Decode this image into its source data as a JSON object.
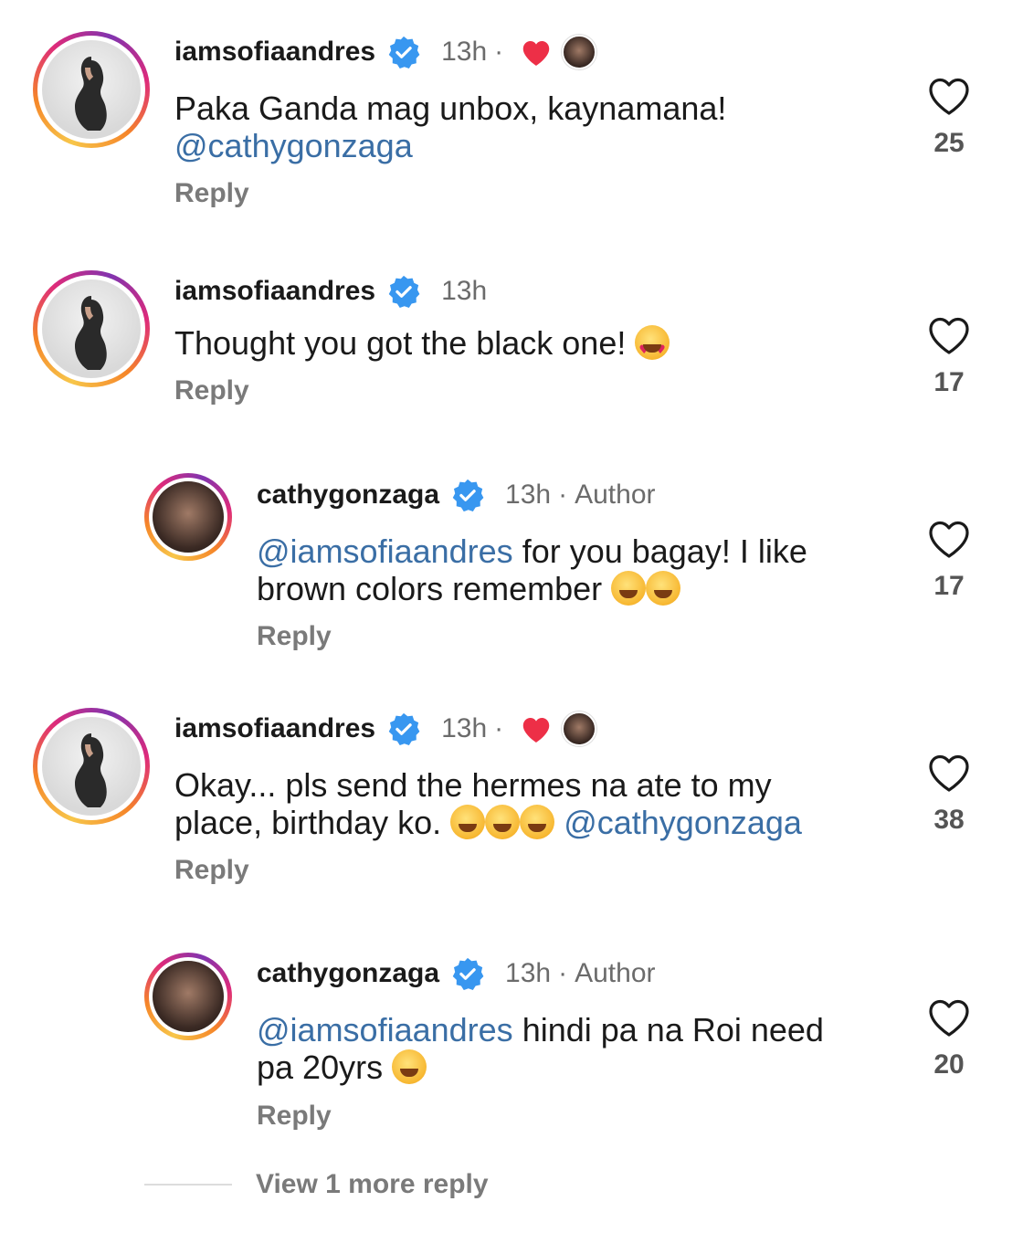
{
  "colors": {
    "mention": "#3a6ea5",
    "verified": "#3897f0",
    "like_red": "#ed2f47"
  },
  "comments": [
    {
      "username": "iamsofiaandres",
      "time": "13h",
      "author_label": "",
      "liked_by_author": true,
      "text_before": "Paka Ganda mag unbox, kaynamana!",
      "mention": "@cathygonzaga",
      "text_after": "",
      "reply": "Reply",
      "likes": "25"
    },
    {
      "username": "iamsofiaandres",
      "time": "13h",
      "author_label": "",
      "liked_by_author": false,
      "text_before": "Thought you got the black one!",
      "mention": "",
      "text_after": "",
      "reply": "Reply",
      "likes": "17"
    },
    {
      "username": "cathygonzaga",
      "time": "13h",
      "author_label": "Author",
      "liked_by_author": false,
      "mention": "@iamsofiaandres",
      "text_after": "for you bagay! I like brown colors remember",
      "reply": "Reply",
      "likes": "17"
    },
    {
      "username": "iamsofiaandres",
      "time": "13h",
      "author_label": "",
      "liked_by_author": true,
      "text_before": "Okay... pls send the hermes na ate to my place, birthday ko.",
      "mention": "@cathygonzaga",
      "reply": "Reply",
      "likes": "38"
    },
    {
      "username": "cathygonzaga",
      "time": "13h",
      "author_label": "Author",
      "liked_by_author": false,
      "mention": "@iamsofiaandres",
      "text_after": "hindi pa na Roi need pa 20yrs",
      "reply": "Reply",
      "likes": "20"
    }
  ],
  "meta": {
    "dot": "·"
  },
  "view_more": "View 1 more reply"
}
